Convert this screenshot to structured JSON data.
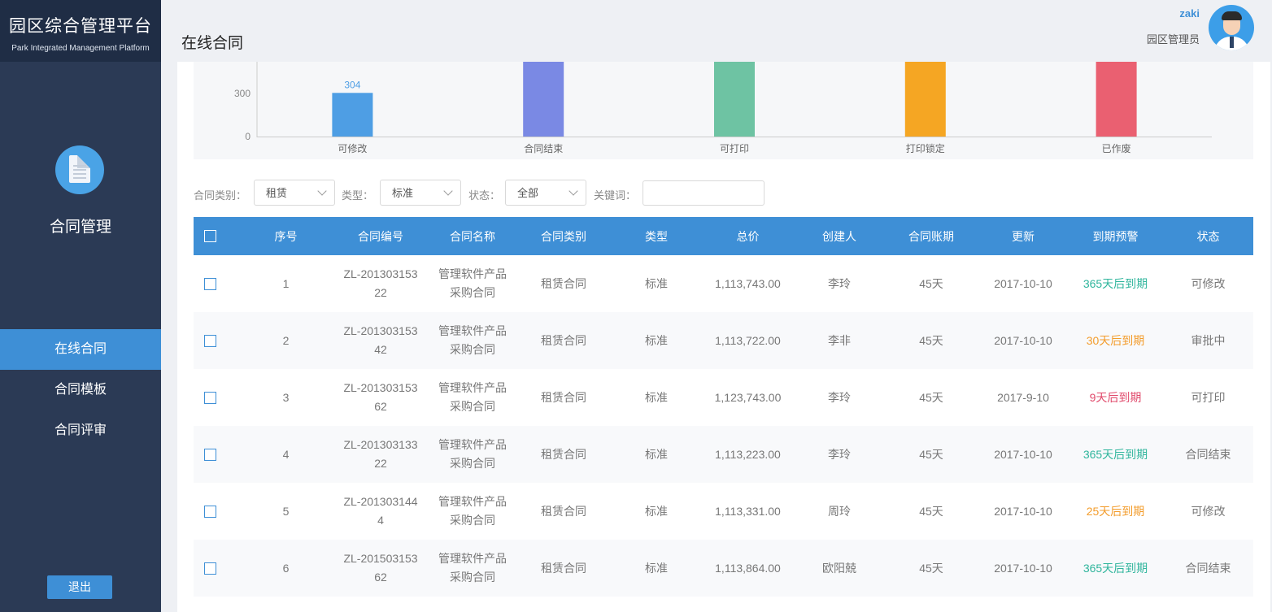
{
  "brand": {
    "title": "园区综合管理平台",
    "subtitle": "Park Integrated Management Platform"
  },
  "sidebar": {
    "module": "合同管理",
    "items": [
      {
        "label": "在线合同",
        "active": true
      },
      {
        "label": "合同模板",
        "active": false
      },
      {
        "label": "合同评审",
        "active": false
      }
    ],
    "logout": "退出"
  },
  "header": {
    "title": "在线合同",
    "user_name": "zaki",
    "user_role": "园区管理员"
  },
  "colors": {
    "primary": "#3e8fd6",
    "sidebar": "#2b3a55",
    "green": "#2fb59c",
    "orange": "#f39c2b",
    "red": "#e0486a"
  },
  "chart_data": {
    "type": "bar",
    "categories": [
      "可修改",
      "合同结束",
      "可打印",
      "打印锁定",
      "已作废"
    ],
    "values": [
      304,
      null,
      null,
      null,
      null
    ],
    "visible_data_label": "304",
    "bar_colors": [
      "#4e9ee4",
      "#7a89e4",
      "#6ec3a3",
      "#f5a623",
      "#ea6071"
    ],
    "yticks": [
      "300",
      "0"
    ],
    "visible_ylim": [
      0,
      330
    ],
    "note_values": "only the bottom portion of the chart is visible; bars other than 可修改 extend beyond the visible range"
  },
  "filters": {
    "category_label": "合同类别：",
    "category_value": "租赁",
    "type_label": "类型：",
    "type_value": "标准",
    "status_label": "状态：",
    "status_value": "全部",
    "keyword_label": "关键词：",
    "keyword_value": ""
  },
  "table": {
    "headers": [
      "序号",
      "合同编号",
      "合同名称",
      "合同类别",
      "类型",
      "总价",
      "创建人",
      "合同账期",
      "更新",
      "到期预警",
      "状态"
    ],
    "rows": [
      {
        "no": "1",
        "code1": "ZL-201303153",
        "code2": "22",
        "name1": "管理软件产品",
        "name2": "采购合同",
        "category": "租赁合同",
        "type": "标准",
        "price": "1,113,743.00",
        "creator": "李玲",
        "term": "45天",
        "updated": "2017-10-10",
        "warning": "365天后到期",
        "warn_level": "green",
        "status": "可修改"
      },
      {
        "no": "2",
        "code1": "ZL-201303153",
        "code2": "42",
        "name1": "管理软件产品",
        "name2": "采购合同",
        "category": "租赁合同",
        "type": "标准",
        "price": "1,113,722.00",
        "creator": "李非",
        "term": "45天",
        "updated": "2017-10-10",
        "warning": "30天后到期",
        "warn_level": "orange",
        "status": "审批中"
      },
      {
        "no": "3",
        "code1": "ZL-201303153",
        "code2": "62",
        "name1": "管理软件产品",
        "name2": "采购合同",
        "category": "租赁合同",
        "type": "标准",
        "price": "1,123,743.00",
        "creator": "李玲",
        "term": "45天",
        "updated": "2017-9-10",
        "warning": "9天后到期",
        "warn_level": "red",
        "status": "可打印"
      },
      {
        "no": "4",
        "code1": "ZL-201303133",
        "code2": "22",
        "name1": "管理软件产品",
        "name2": "采购合同",
        "category": "租赁合同",
        "type": "标准",
        "price": "1,113,223.00",
        "creator": "李玲",
        "term": "45天",
        "updated": "2017-10-10",
        "warning": "365天后到期",
        "warn_level": "green",
        "status": "合同结束"
      },
      {
        "no": "5",
        "code1": "ZL-201303144",
        "code2": "4",
        "name1": "管理软件产品",
        "name2": "采购合同",
        "category": "租赁合同",
        "type": "标准",
        "price": "1,113,331.00",
        "creator": "周玲",
        "term": "45天",
        "updated": "2017-10-10",
        "warning": "25天后到期",
        "warn_level": "orange",
        "status": "可修改"
      },
      {
        "no": "6",
        "code1": "ZL-201503153",
        "code2": "62",
        "name1": "管理软件产品",
        "name2": "采购合同",
        "category": "租赁合同",
        "type": "标准",
        "price": "1,113,864.00",
        "creator": "欧阳兢",
        "term": "45天",
        "updated": "2017-10-10",
        "warning": "365天后到期",
        "warn_level": "green",
        "status": "合同结束"
      }
    ]
  }
}
